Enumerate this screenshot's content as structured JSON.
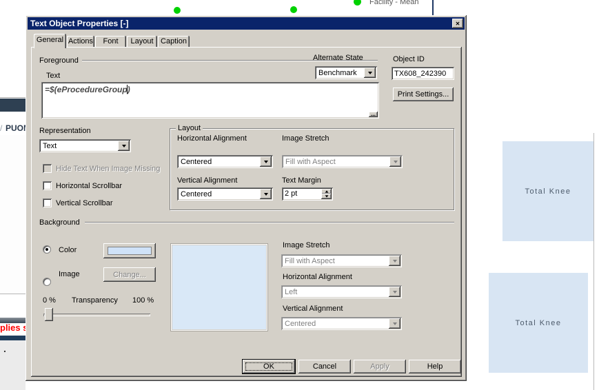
{
  "colors": {
    "title_bar": "#0a246a",
    "dialog_face": "#d4d0c8",
    "swatch_blue": "#cfe2f8",
    "preview_blue": "#d9e8f7",
    "dot_green": "#00d200",
    "box_blue": "#d8e5f3",
    "dark_bar": "#2e4052",
    "navy_bar": "#1f3d5c"
  },
  "underlying_app": {
    "legend": {
      "label": "Facility - Mean"
    },
    "left_panel": {
      "column_header_prefix": "/",
      "column_header": "PUOM",
      "red_text": "plies s",
      "period": "."
    },
    "boxes": [
      {
        "label": "Total Knee"
      },
      {
        "label": "Total Knee"
      }
    ]
  },
  "dialog": {
    "title": "Text Object Properties [-]",
    "close_glyph": "✕",
    "tabs": [
      {
        "label": "General",
        "active": true
      },
      {
        "label": "Actions"
      },
      {
        "label": "Font"
      },
      {
        "label": "Layout"
      },
      {
        "label": "Caption"
      }
    ],
    "general": {
      "foreground": {
        "section_label": "Foreground",
        "text_label": "Text",
        "text_value": "=$(eProcedureGroup)",
        "more_button": "..."
      },
      "alternate_state": {
        "label": "Alternate State",
        "value": "Benchmark"
      },
      "object_id": {
        "label": "Object ID",
        "value": "TX608_242390"
      },
      "print_settings_label": "Print Settings...",
      "representation": {
        "label": "Representation",
        "value": "Text"
      },
      "checkboxes": [
        {
          "label": "Hide Text When Image Missing",
          "disabled": true
        },
        {
          "label": "Horizontal Scrollbar"
        },
        {
          "label": "Vertical Scrollbar"
        }
      ],
      "layout_group": {
        "title": "Layout",
        "horizontal_alignment": {
          "label": "Horizontal Alignment",
          "value": "Centered"
        },
        "image_stretch": {
          "label": "Image Stretch",
          "value": "Fill with Aspect"
        },
        "vertical_alignment": {
          "label": "Vertical Alignment",
          "value": "Centered"
        },
        "text_margin": {
          "label": "Text Margin",
          "value": "2 pt"
        }
      },
      "background_group": {
        "title": "Background",
        "color_radio_label": "Color",
        "image_radio_label": "Image",
        "change_button": "Change...",
        "transparency": {
          "min": "0 %",
          "label": "Transparency",
          "max": "100 %"
        },
        "image_stretch": {
          "label": "Image Stretch",
          "value": "Fill with Aspect"
        },
        "horizontal_alignment": {
          "label": "Horizontal Alignment",
          "value": "Left"
        },
        "vertical_alignment": {
          "label": "Vertical Alignment",
          "value": "Centered"
        }
      },
      "buttons": {
        "ok": "OK",
        "cancel": "Cancel",
        "apply": "Apply",
        "help": "Help"
      }
    }
  }
}
